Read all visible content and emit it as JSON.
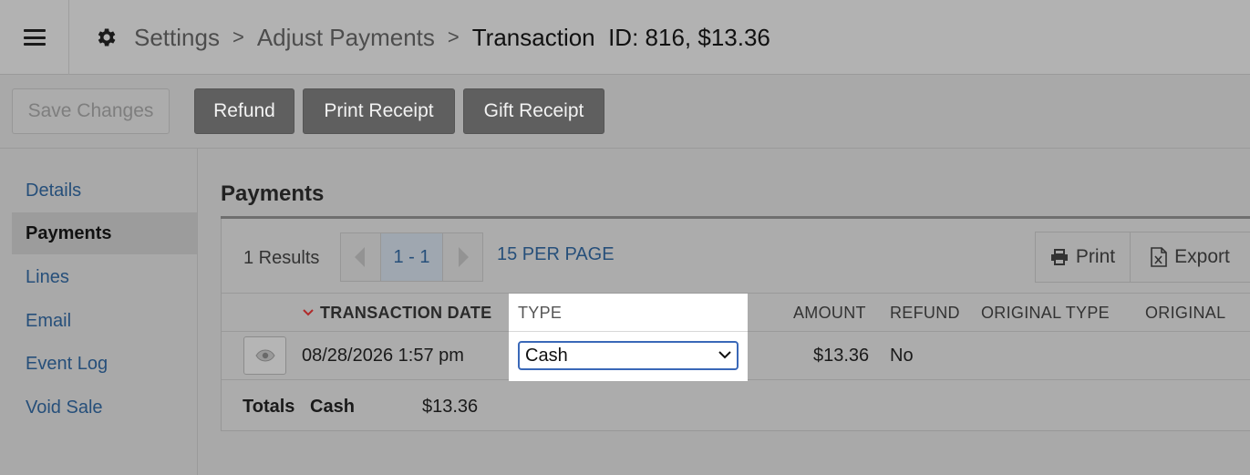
{
  "header": {
    "settings_label": "Settings",
    "adjust_label": "Adjust Payments",
    "current_label": "Transaction  ID: 816, $13.36",
    "separator": ">"
  },
  "toolbar": {
    "save_label": "Save Changes",
    "refund_label": "Refund",
    "print_receipt_label": "Print Receipt",
    "gift_receipt_label": "Gift Receipt"
  },
  "sidebar": {
    "items": [
      {
        "label": "Details"
      },
      {
        "label": "Payments"
      },
      {
        "label": "Lines"
      },
      {
        "label": "Email"
      },
      {
        "label": "Event Log"
      },
      {
        "label": "Void Sale"
      }
    ],
    "active": "Payments"
  },
  "payments": {
    "title": "Payments",
    "results": "1 Results",
    "page_range": "1 - 1",
    "per_page": "15 PER PAGE",
    "print_label": "Print",
    "export_label": "Export",
    "columns": {
      "date": "TRANSACTION DATE",
      "type": "TYPE",
      "amount": "AMOUNT",
      "refund": "REFUND",
      "original_type": "ORIGINAL TYPE",
      "original": "ORIGINAL"
    },
    "rows": [
      {
        "date": "08/28/2026 1:57 pm",
        "type": "Cash",
        "amount": "$13.36",
        "refund": "No"
      }
    ],
    "totals": {
      "label": "Totals",
      "type": "Cash",
      "amount": "$13.36"
    }
  },
  "colors": {
    "link": "#264f7a",
    "select_border": "#3a68b8"
  }
}
